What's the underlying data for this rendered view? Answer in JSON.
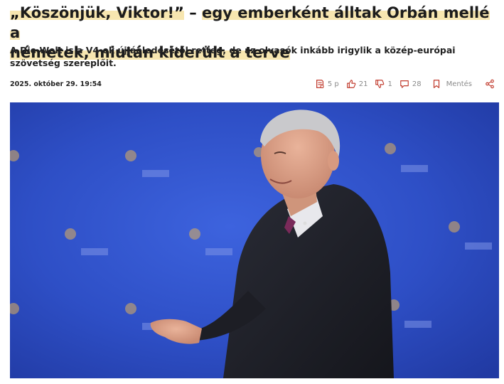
{
  "article": {
    "title_open_quote": "„",
    "title_part1": "Köszönjük, Viktor!",
    "title_close_quote": "”",
    "title_dash": " – ",
    "title_part2a": "egy emberként álltak Orbán mellé a",
    "title_part2b": "németek, miután kiderült a terve",
    "lead": "A Die Welt is a V4-ek újjáéledésétől retteg, de az olvasók inkább irigylik a közép-európai szövetség szereplőit.",
    "date": "2025. október 29. 19:54"
  },
  "actions": {
    "reading_time": "5 p",
    "likes": "21",
    "dislikes": "1",
    "comments": "28",
    "save_label": "Mentés"
  },
  "colors": {
    "accent": "#c0392b",
    "highlight": "#f7e6b0",
    "photo_background": "#2f4fc9"
  },
  "icons": [
    "reading-time-icon",
    "thumbs-up-icon",
    "thumbs-down-icon",
    "comment-icon",
    "bookmark-icon",
    "share-icon"
  ]
}
